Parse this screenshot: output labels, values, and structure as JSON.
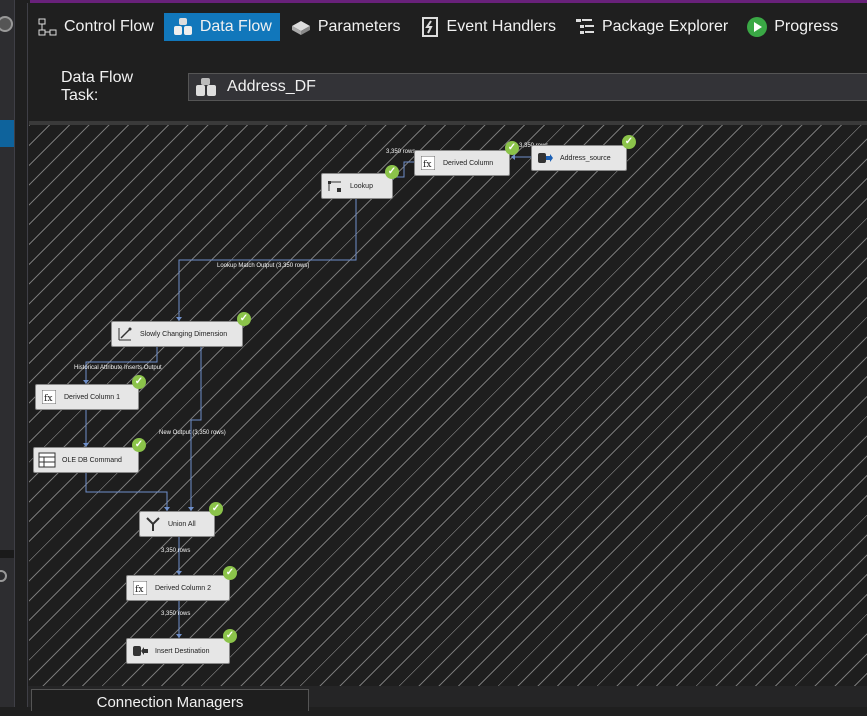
{
  "tabs": [
    {
      "label": "Control Flow",
      "icon": "control-flow-icon",
      "active": false
    },
    {
      "label": "Data Flow",
      "icon": "data-flow-icon",
      "active": true
    },
    {
      "label": "Parameters",
      "icon": "parameters-icon",
      "active": false
    },
    {
      "label": "Event Handlers",
      "icon": "event-handlers-icon",
      "active": false
    },
    {
      "label": "Package Explorer",
      "icon": "package-explorer-icon",
      "active": false
    },
    {
      "label": "Progress",
      "icon": "progress-play-icon",
      "active": false
    }
  ],
  "task": {
    "label": "Data Flow Task:",
    "value": "Address_DF"
  },
  "components": {
    "address_source": "Address_source",
    "derived_column": "Derived Column",
    "lookup": "Lookup",
    "scd": "Slowly Changing Dimension",
    "derived_column_1": "Derived Column 1",
    "ole_db_command": "OLE DB Command",
    "union_all": "Union All",
    "derived_column_2": "Derived Column 2",
    "insert_destination": "Insert Destination"
  },
  "paths": {
    "rows_source": "3,350 rows",
    "rows_derived": "3,350 rows",
    "lookup_match": "Lookup Match Output (3,350 rows)",
    "historical": "Historical Attribute Inserts Output",
    "new_output": "New Output (3,350 rows)",
    "rows_union": "3,350 rows",
    "rows_derived2": "3,350 rows"
  },
  "bottom": {
    "connection_managers": "Connection Managers"
  },
  "colors": {
    "accent": "#1177bb",
    "check": "#8bc34a",
    "wire": "#6f8fc9"
  }
}
